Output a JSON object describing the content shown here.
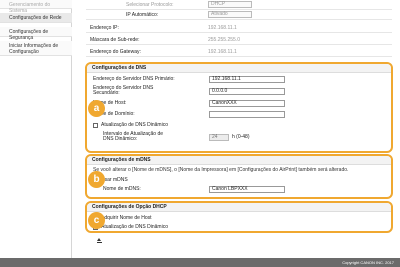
{
  "sidebar": {
    "items": [
      {
        "label": "Gerenciamento do Sistema"
      },
      {
        "label": "Configurações de Rede"
      },
      {
        "label": "Configurações de Segurança"
      },
      {
        "label": "Iniciar Informações de Configuração"
      }
    ]
  },
  "top": {
    "protocol_label": "Selecionar Protocolo:",
    "protocol_value": "DHCP",
    "auto_ip_label": "IP Automático:",
    "auto_ip_value": "Ativado",
    "ip_label": "Endereço IP:",
    "ip_value": "192.168.11.1",
    "subnet_label": "Máscara de Sub-rede:",
    "subnet_value": "255.255.255.0",
    "gateway_label": "Endereço do Gateway:",
    "gateway_value": "192.168.11.1"
  },
  "dns": {
    "title": "Configurações de DNS",
    "primary_label": "Endereço do Servidor DNS Primário:",
    "primary_value": "192.168.11.1",
    "secondary_label": "Endereço do Servidor DNS Secundário:",
    "secondary_value": "0.0.0.0",
    "host_label": "Nome de Host:",
    "host_value": "CanonXXX",
    "domain_label": "Nome de Domínio:",
    "domain_value": "",
    "dynamic_label": "Atualização de DNS Dinâmico",
    "dynamic_checked": false,
    "interval_label": "Intervalo de Atualização de DNS Dinâmico:",
    "interval_value": "24",
    "interval_unit": "h (0-48)"
  },
  "mdns": {
    "title": "Configurações de mDNS",
    "note": "Se você alterar o [Nome de mDNS], o [Nome da Impressora] em [Configurações do AirPrint] também será alterado.",
    "use_label": "Usar mDNS",
    "use_checked": true,
    "name_label": "Nome de mDNS:",
    "name_value": "Canon LBPXXX"
  },
  "dhcp": {
    "title": "Configurações de Opção DHCP",
    "host_label": "Adquirir Nome de Host",
    "host_checked": true,
    "dynamic_label": "Atualização de DNS Dinâmico",
    "dynamic_checked": false
  },
  "badges": {
    "a": "a",
    "b": "b",
    "c": "c"
  },
  "footer": {
    "copyright": "Copyright CANON INC. 2017"
  },
  "colors": {
    "accent": "#f0a830",
    "footer": "#6b6b6b"
  }
}
